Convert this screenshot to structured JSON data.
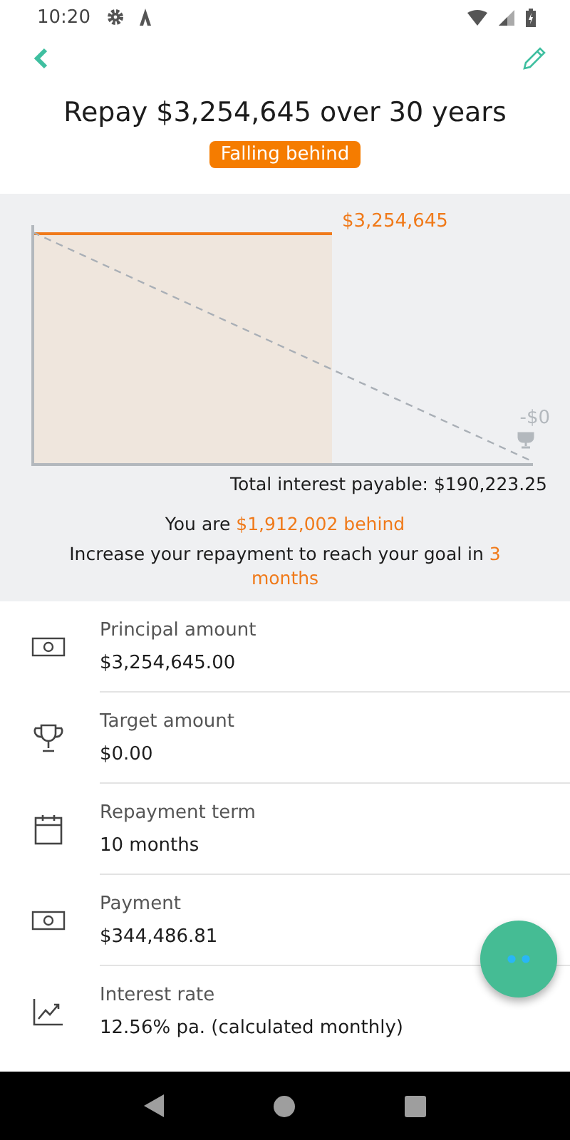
{
  "status_bar": {
    "time": "10:20"
  },
  "title": "Repay $3,254,645 over 30 years",
  "badge": "Falling behind",
  "chart": {
    "top_label": "$3,254,645",
    "end_label": "-$0"
  },
  "total_interest": "Total interest payable: $190,223.25",
  "behind": [
    {
      "text": "You are ",
      "highlight": false
    },
    {
      "text": "$1,912,002 behind",
      "highlight": true
    }
  ],
  "advice": [
    {
      "text": "Increase your repayment to reach your goal in ",
      "highlight": false
    },
    {
      "text": "3 months",
      "highlight": true
    }
  ],
  "details": [
    {
      "kind": "money",
      "label": "Principal amount",
      "value": "$3,254,645.00"
    },
    {
      "kind": "trophy",
      "label": "Target amount",
      "value": "$0.00"
    },
    {
      "kind": "calendar",
      "label": "Repayment term",
      "value": "10 months"
    },
    {
      "kind": "money",
      "label": "Payment",
      "value": "$344,486.81"
    },
    {
      "kind": "trend",
      "label": "Interest rate",
      "value": "12.56% pa. (calculated monthly)"
    }
  ]
}
